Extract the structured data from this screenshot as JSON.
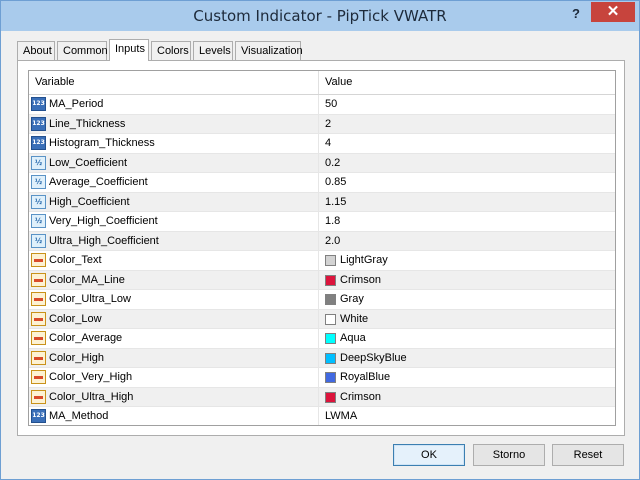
{
  "window": {
    "title": "Custom Indicator - PipTick VWATR",
    "help_label": "?",
    "close_label": "✕"
  },
  "tabs": [
    {
      "label": "About",
      "active": false
    },
    {
      "label": "Common",
      "active": false
    },
    {
      "label": "Inputs",
      "active": true
    },
    {
      "label": "Colors",
      "active": false
    },
    {
      "label": "Levels",
      "active": false
    },
    {
      "label": "Visualization",
      "active": false
    }
  ],
  "grid": {
    "columns": [
      "Variable",
      "Value"
    ],
    "rows": [
      {
        "type": "int",
        "icon": "integer-icon",
        "name": "MA_Period",
        "value": "50"
      },
      {
        "type": "int",
        "icon": "integer-icon",
        "name": "Line_Thickness",
        "value": "2"
      },
      {
        "type": "int",
        "icon": "integer-icon",
        "name": "Histogram_Thickness",
        "value": "4"
      },
      {
        "type": "double",
        "icon": "double-icon",
        "name": "Low_Coefficient",
        "value": "0.2"
      },
      {
        "type": "double",
        "icon": "double-icon",
        "name": "Average_Coefficient",
        "value": "0.85"
      },
      {
        "type": "double",
        "icon": "double-icon",
        "name": "High_Coefficient",
        "value": "1.15"
      },
      {
        "type": "double",
        "icon": "double-icon",
        "name": "Very_High_Coefficient",
        "value": "1.8"
      },
      {
        "type": "double",
        "icon": "double-icon",
        "name": "Ultra_High_Coefficient",
        "value": "2.0"
      },
      {
        "type": "color",
        "icon": "color-icon",
        "name": "Color_Text",
        "value": "LightGray",
        "swatch": "#d3d3d3"
      },
      {
        "type": "color",
        "icon": "color-icon",
        "name": "Color_MA_Line",
        "value": "Crimson",
        "swatch": "#dc143c"
      },
      {
        "type": "color",
        "icon": "color-icon",
        "name": "Color_Ultra_Low",
        "value": "Gray",
        "swatch": "#808080"
      },
      {
        "type": "color",
        "icon": "color-icon",
        "name": "Color_Low",
        "value": "White",
        "swatch": "#ffffff"
      },
      {
        "type": "color",
        "icon": "color-icon",
        "name": "Color_Average",
        "value": "Aqua",
        "swatch": "#00ffff"
      },
      {
        "type": "color",
        "icon": "color-icon",
        "name": "Color_High",
        "value": "DeepSkyBlue",
        "swatch": "#00bfff"
      },
      {
        "type": "color",
        "icon": "color-icon",
        "name": "Color_Very_High",
        "value": "RoyalBlue",
        "swatch": "#4169e1"
      },
      {
        "type": "color",
        "icon": "color-icon",
        "name": "Color_Ultra_High",
        "value": "Crimson",
        "swatch": "#dc143c"
      },
      {
        "type": "int",
        "icon": "integer-icon",
        "name": "MA_Method",
        "value": "LWMA"
      }
    ]
  },
  "buttons": {
    "ok": "OK",
    "cancel": "Storno",
    "reset": "Reset"
  }
}
